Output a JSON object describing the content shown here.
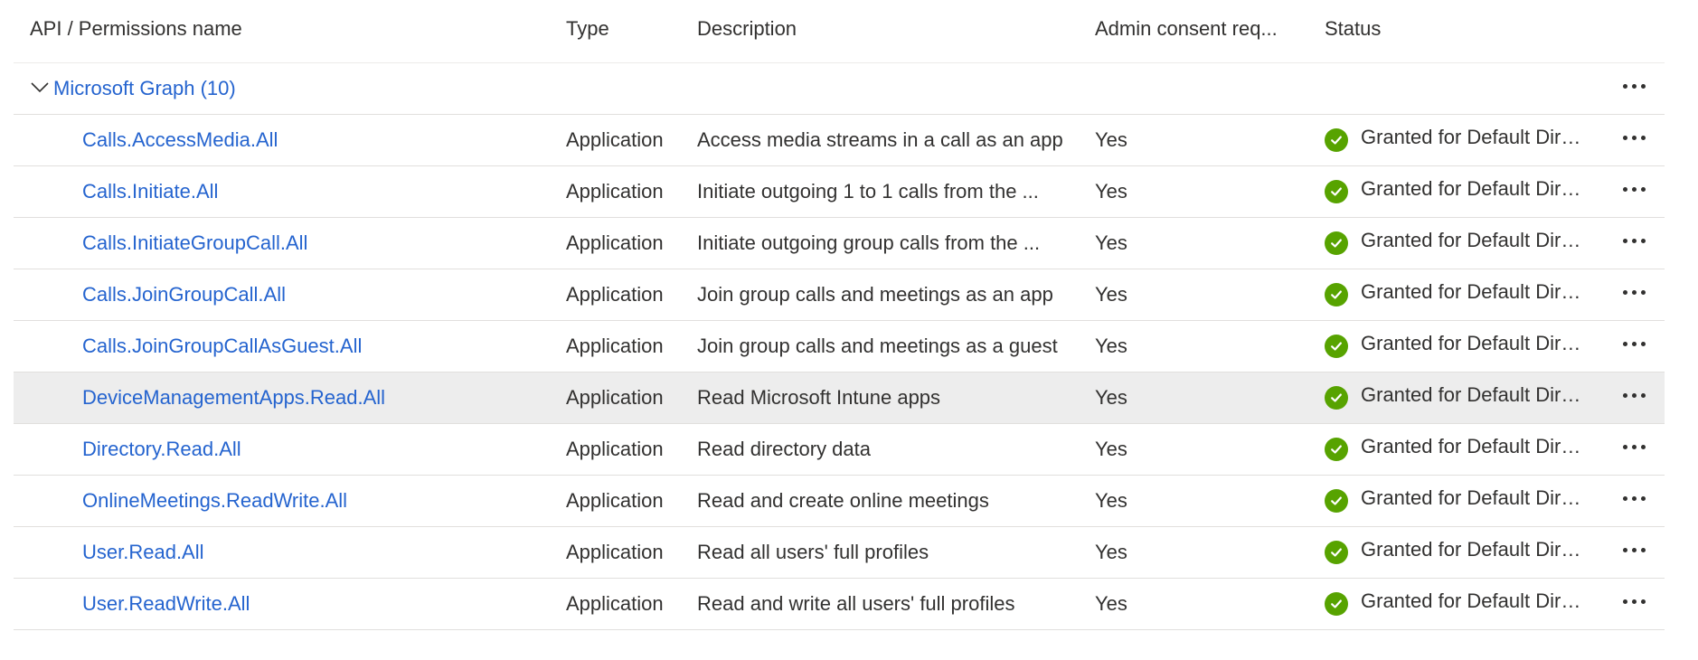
{
  "columns": {
    "name": "API / Permissions name",
    "type": "Type",
    "description": "Description",
    "admin_consent": "Admin consent req...",
    "status": "Status"
  },
  "group": {
    "label": "Microsoft Graph (10)"
  },
  "rows": [
    {
      "name": "Calls.AccessMedia.All",
      "type": "Application",
      "description": "Access media streams in a call as an app",
      "admin": "Yes",
      "status": "Granted for Default Dire..."
    },
    {
      "name": "Calls.Initiate.All",
      "type": "Application",
      "description": "Initiate outgoing 1 to 1 calls from the ...",
      "admin": "Yes",
      "status": "Granted for Default Dire..."
    },
    {
      "name": "Calls.InitiateGroupCall.All",
      "type": "Application",
      "description": "Initiate outgoing group calls from the ...",
      "admin": "Yes",
      "status": "Granted for Default Dire..."
    },
    {
      "name": "Calls.JoinGroupCall.All",
      "type": "Application",
      "description": "Join group calls and meetings as an app",
      "admin": "Yes",
      "status": "Granted for Default Dire..."
    },
    {
      "name": "Calls.JoinGroupCallAsGuest.All",
      "type": "Application",
      "description": "Join group calls and meetings as a guest",
      "admin": "Yes",
      "status": "Granted for Default Dire..."
    },
    {
      "name": "DeviceManagementApps.Read.All",
      "type": "Application",
      "description": "Read Microsoft Intune apps",
      "admin": "Yes",
      "status": "Granted for Default Dire..."
    },
    {
      "name": "Directory.Read.All",
      "type": "Application",
      "description": "Read directory data",
      "admin": "Yes",
      "status": "Granted for Default Dire..."
    },
    {
      "name": "OnlineMeetings.ReadWrite.All",
      "type": "Application",
      "description": "Read and create online meetings",
      "admin": "Yes",
      "status": "Granted for Default Dire..."
    },
    {
      "name": "User.Read.All",
      "type": "Application",
      "description": "Read all users' full profiles",
      "admin": "Yes",
      "status": "Granted for Default Dire..."
    },
    {
      "name": "User.ReadWrite.All",
      "type": "Application",
      "description": "Read and write all users' full profiles",
      "admin": "Yes",
      "status": "Granted for Default Dire..."
    }
  ],
  "colors": {
    "link": "#2564cf",
    "granted": "#57a300",
    "selected_row": "#ededed",
    "divider": "#e1dfdd"
  },
  "icons": {
    "expand": "chevron-down-icon",
    "status": "check-circle-icon",
    "more": "more-icon"
  }
}
